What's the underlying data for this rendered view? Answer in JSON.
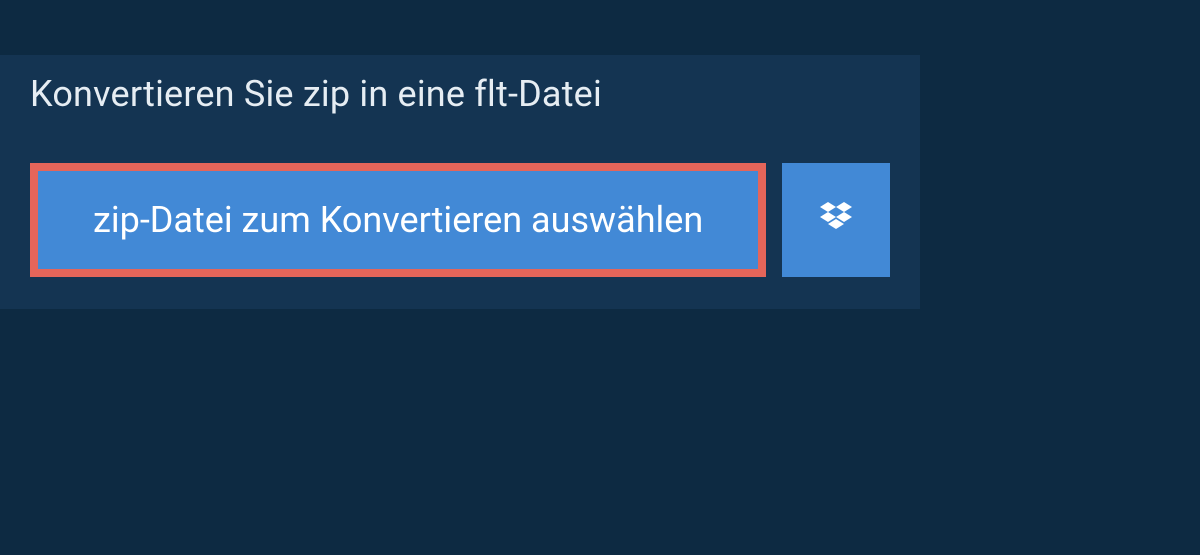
{
  "header": {
    "title": "Konvertieren Sie zip in eine flt-Datei"
  },
  "actions": {
    "select_file_label": "zip-Datei zum Konvertieren auswählen"
  },
  "colors": {
    "page_bg": "#0d2a42",
    "panel_bg": "#143452",
    "button_bg": "#4289d6",
    "highlight_border": "#e4655a",
    "text_light": "#e6edf3"
  }
}
